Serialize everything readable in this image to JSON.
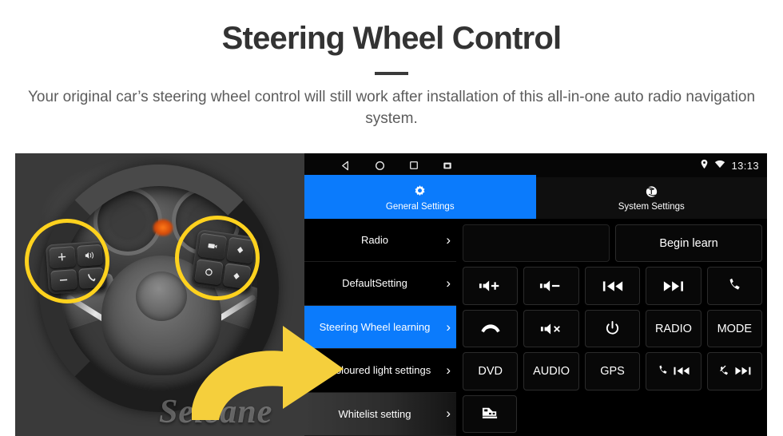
{
  "header": {
    "title": "Steering Wheel Control",
    "subtitle": "Your original car’s steering wheel control will still work after installation of this all-in-one auto radio navigation system."
  },
  "photo": {
    "watermark": "Seicane",
    "highlight_color": "#FFD21E",
    "arrow_color": "#F5CF3C",
    "left_cluster_keys": [
      "+",
      "voice-icon",
      "−",
      "call-icon"
    ],
    "right_cluster_keys": [
      "source-icon",
      "up-icon",
      "mode-icon",
      "down-icon"
    ]
  },
  "device": {
    "statusbar": {
      "nav_icons": [
        "back-icon",
        "home-icon",
        "recents-icon",
        "screenshot-icon"
      ],
      "status_icons": [
        "location-icon",
        "wifi-icon"
      ],
      "clock": "13:13",
      "accent": "#0b7bfc"
    },
    "tabs": [
      {
        "label": "General Settings",
        "icon": "gear-icon",
        "active": true
      },
      {
        "label": "System Settings",
        "icon": "system-logo-icon",
        "active": false
      }
    ],
    "sidebar": [
      {
        "label": "Radio",
        "state": "normal"
      },
      {
        "label": "DefaultSetting",
        "state": "normal"
      },
      {
        "label": "Steering Wheel learning",
        "state": "active"
      },
      {
        "label": "Tricoloured light settings",
        "state": "normal"
      },
      {
        "label": "Whitelist setting",
        "state": "dim"
      }
    ],
    "chevron": "›",
    "panel": {
      "rows": [
        [
          {
            "type": "field",
            "value": "",
            "name": "learn-value-field"
          },
          {
            "type": "text",
            "value": "Begin learn",
            "name": "begin-learn-button"
          }
        ],
        [
          {
            "type": "icon",
            "value": "volume-up-icon",
            "name": "volume-up-button"
          },
          {
            "type": "icon",
            "value": "volume-down-icon",
            "name": "volume-down-button"
          },
          {
            "type": "icon",
            "value": "previous-track-icon",
            "name": "previous-track-button"
          },
          {
            "type": "icon",
            "value": "next-track-icon",
            "name": "next-track-button"
          },
          {
            "type": "icon",
            "value": "call-answer-icon",
            "name": "call-answer-button"
          }
        ],
        [
          {
            "type": "icon",
            "value": "call-hangup-icon",
            "name": "call-hangup-button"
          },
          {
            "type": "icon",
            "value": "mute-icon",
            "name": "mute-button"
          },
          {
            "type": "icon",
            "value": "power-icon",
            "name": "power-button"
          },
          {
            "type": "text",
            "value": "RADIO",
            "name": "radio-button"
          },
          {
            "type": "text",
            "value": "MODE",
            "name": "mode-button"
          }
        ],
        [
          {
            "type": "text",
            "value": "DVD",
            "name": "dvd-button"
          },
          {
            "type": "text",
            "value": "AUDIO",
            "name": "audio-button"
          },
          {
            "type": "text",
            "value": "GPS",
            "name": "gps-button"
          },
          {
            "type": "icon",
            "value": "call-previous-icon",
            "name": "call-previous-button"
          },
          {
            "type": "icon",
            "value": "callend-next-icon",
            "name": "callend-next-button"
          }
        ],
        [
          {
            "type": "icon",
            "value": "car-icon",
            "name": "car-button"
          }
        ]
      ]
    }
  }
}
